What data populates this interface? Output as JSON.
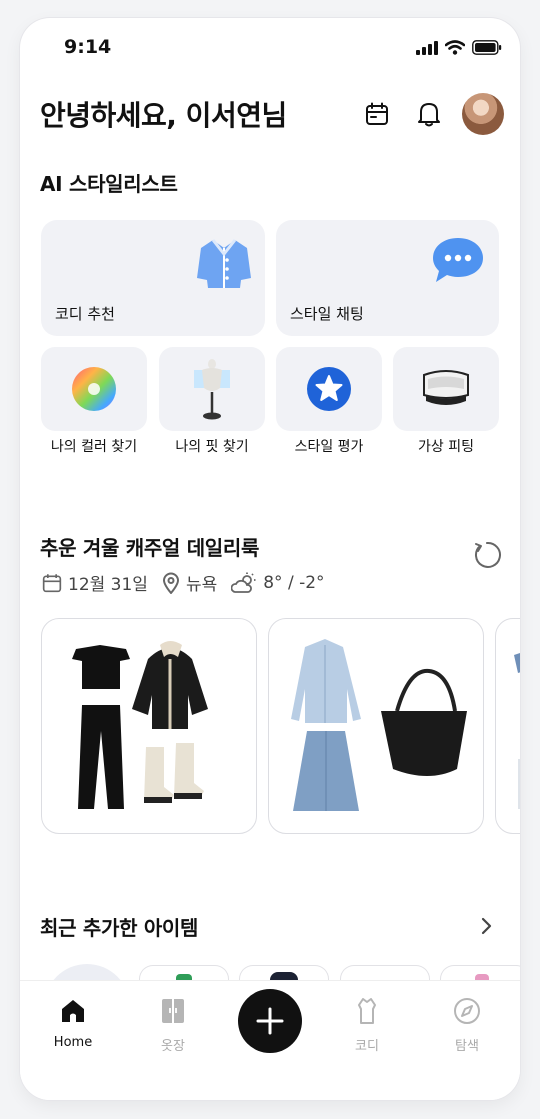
{
  "status_bar": {
    "time": "9:14"
  },
  "header": {
    "greeting": "안녕하세요, 이서연님"
  },
  "ai_section": {
    "title": "AI 스타일리스트",
    "large_cards": [
      {
        "label": "코디 추천",
        "icon": "cardigan-icon"
      },
      {
        "label": "스타일 채팅",
        "icon": "chat-bubble-icon"
      }
    ],
    "small_cards": [
      {
        "label": "나의 컬러 찾기",
        "icon": "color-wheel-icon"
      },
      {
        "label": "나의 핏 찾기",
        "icon": "mannequin-icon"
      },
      {
        "label": "스타일 평가",
        "icon": "star-badge-icon"
      },
      {
        "label": "가상 피팅",
        "icon": "vr-headset-icon"
      }
    ]
  },
  "daily_look": {
    "title": "추운 겨울 캐주얼 데일리룩",
    "date": "12월 31일",
    "location": "뉴욕",
    "weather": "8° / -2°"
  },
  "recent_items": {
    "title": "최근 추가한 아이템"
  },
  "tab_bar": {
    "items": [
      {
        "label": "Home",
        "icon": "home-icon",
        "active": true
      },
      {
        "label": "옷장",
        "icon": "closet-icon",
        "active": false
      },
      {
        "label": "코디",
        "icon": "shirt-icon",
        "active": false
      },
      {
        "label": "탐색",
        "icon": "compass-icon",
        "active": false
      }
    ]
  },
  "colors": {
    "accent": "#111111",
    "card_bg": "#f1f2f6",
    "inactive": "#aaaaaa"
  }
}
